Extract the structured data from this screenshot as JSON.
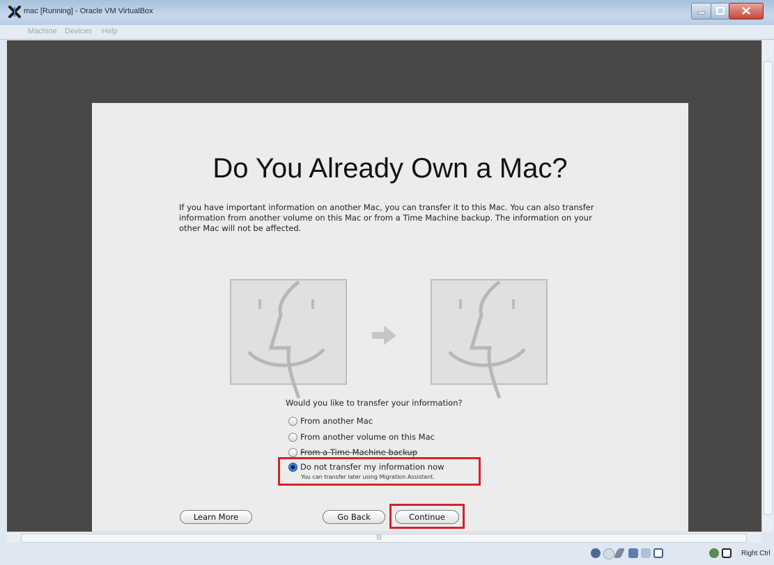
{
  "window": {
    "title": "mac [Running] - Oracle VM VirtualBox",
    "controls": {
      "minimize": "minimize",
      "maximize": "maximize",
      "close": "close"
    }
  },
  "menubar": {
    "items": [
      {
        "label": "Machine"
      },
      {
        "label": "Devices"
      },
      {
        "label": "Help"
      }
    ]
  },
  "setup": {
    "title": "Do You Already Own a Mac?",
    "description": "If you have important information on another Mac, you can transfer it to this Mac. You can also transfer information from another volume on this Mac or from a Time Machine backup. The information on your other Mac will not be affected.",
    "question": "Would you like to transfer your information?",
    "options": [
      {
        "label": "From another Mac",
        "selected": false
      },
      {
        "label": "From another volume on this Mac",
        "selected": false
      },
      {
        "label": "From a Time Machine backup",
        "selected": false
      },
      {
        "label": "Do not transfer my information now",
        "sublabel": "You can transfer later using Migration Assistant.",
        "selected": true
      }
    ],
    "buttons": {
      "learn_more": "Learn More",
      "go_back": "Go Back",
      "continue": "Continue"
    }
  },
  "statusbar": {
    "host_key": "Right Ctrl"
  },
  "colors": {
    "highlight": "#d2232a",
    "vm_background": "#4a4847",
    "panel_background": "#ececec"
  },
  "icons": [
    "virtualbox-icon",
    "finder-face-icon",
    "arrow-right-icon",
    "hdd-icon",
    "optical-icon",
    "usb-icon",
    "network-icon",
    "shared-folder-icon",
    "display-icon",
    "mouse-integration-icon",
    "host-key-icon"
  ]
}
